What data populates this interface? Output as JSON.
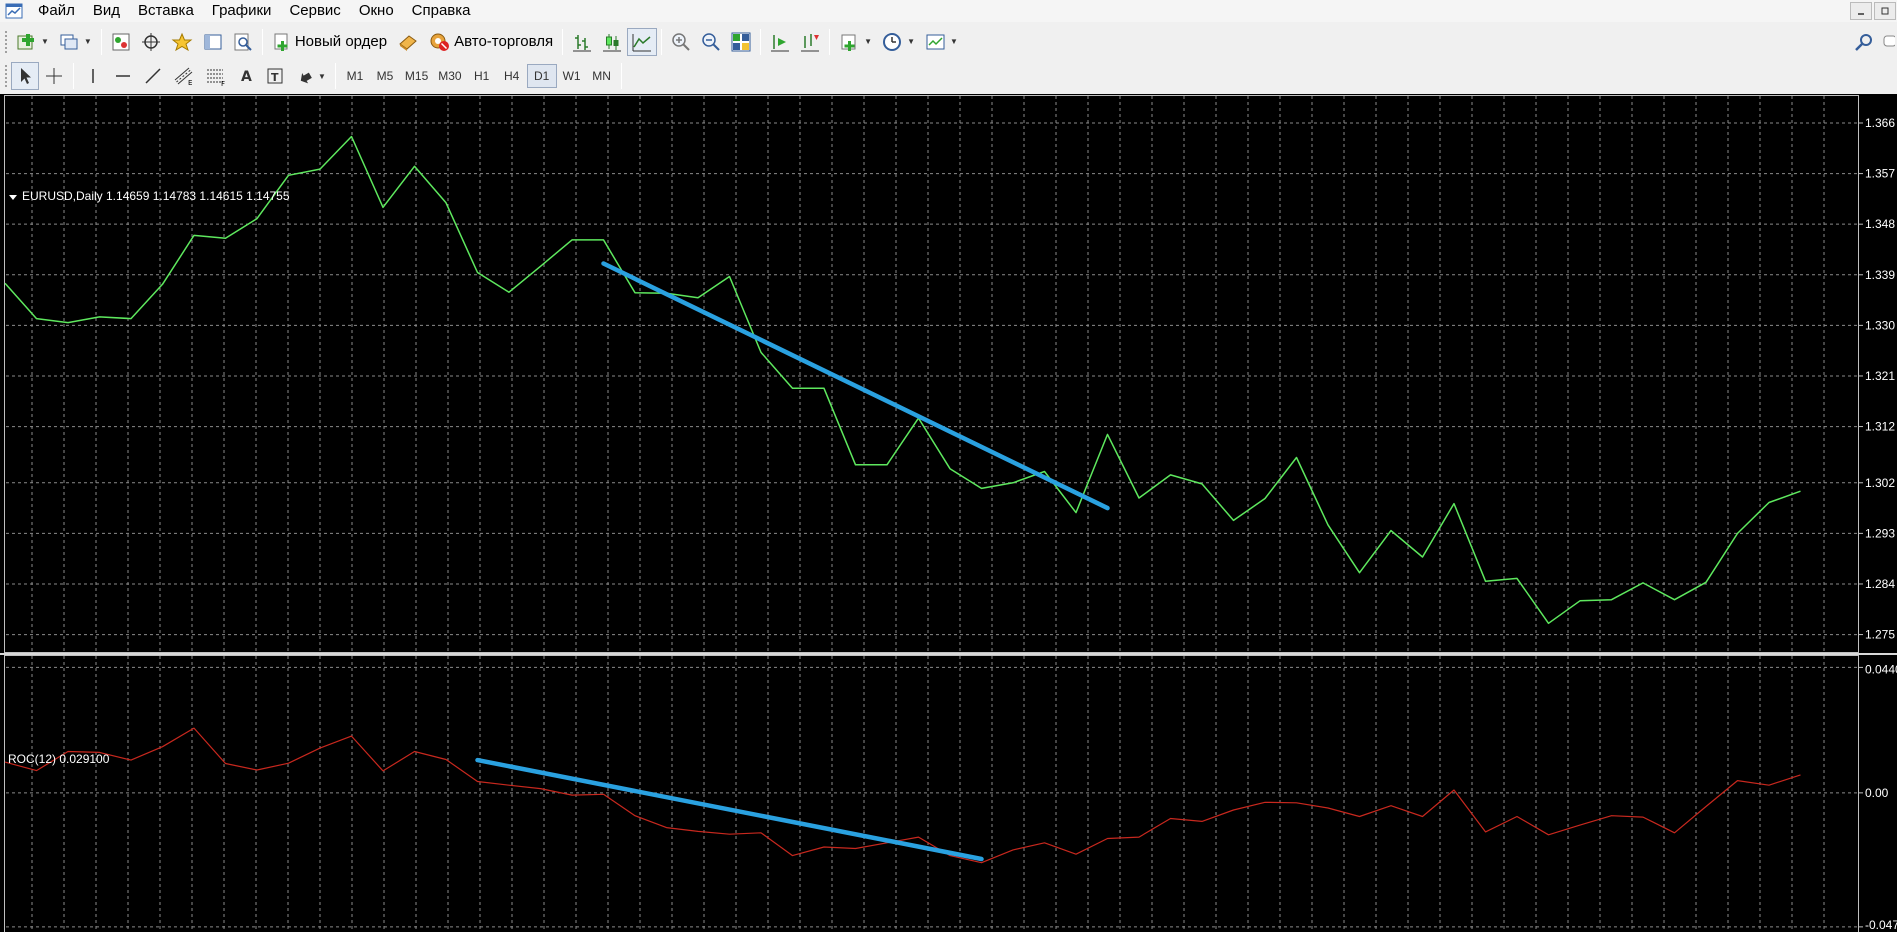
{
  "menu": {
    "items": [
      "Файл",
      "Вид",
      "Вставка",
      "Графики",
      "Сервис",
      "Окно",
      "Справка"
    ]
  },
  "toolbar": {
    "new_order_label": "Новый ордер",
    "autotrading_label": "Авто-торговля",
    "timeframes": [
      "M1",
      "M5",
      "M15",
      "M30",
      "H1",
      "H4",
      "D1",
      "W1",
      "MN"
    ],
    "active_timeframe": "D1"
  },
  "chart": {
    "main_label": "EURUSD,Daily  1.14659 1.14783 1.14615 1.14755",
    "indicator_label": "ROC(12) 0.029100",
    "main_ticks": [
      "1.366",
      "1.357",
      "1.348",
      "1.339",
      "1.330",
      "1.321",
      "1.312",
      "1.302",
      "1.293",
      "1.284",
      "1.275"
    ],
    "indicator_ticks": [
      "0.0440",
      "0.00",
      "-0.047"
    ],
    "colors": {
      "background": "#000000",
      "grid": "#8a8a8a",
      "price_line": "#5ee85e",
      "indicator_line": "#c8281e",
      "trendline": "#2aa1e0",
      "frame": "#c0c0c0"
    }
  },
  "chart_data": [
    {
      "type": "line",
      "title": "EURUSD,Daily  1.14659 1.14783 1.14615 1.14755",
      "series": [
        {
          "values": [
            1.3375,
            1.3312,
            1.3305,
            1.3315,
            1.3312,
            1.3373,
            1.346,
            1.3455,
            1.349,
            1.3567,
            1.3578,
            1.3636,
            1.351,
            1.3583,
            1.3518,
            1.3394,
            1.3359,
            1.3405,
            1.3452,
            1.3452,
            1.3358,
            1.3357,
            1.3349,
            1.3387,
            1.3252,
            1.3188,
            1.3188,
            1.3052,
            1.3052,
            1.3135,
            1.3045,
            1.301,
            1.302,
            1.304,
            1.2967,
            1.3106,
            1.2993,
            1.3034,
            1.3018,
            1.2953,
            1.2992,
            1.3065,
            1.2945,
            1.286,
            1.2935,
            1.2888,
            1.2983,
            1.2845,
            1.285,
            1.277,
            1.281,
            1.2812,
            1.2842,
            1.2812,
            1.2843,
            1.293,
            1.2985,
            1.3005
          ]
        }
      ],
      "ticks": [
        1.366,
        1.357,
        1.348,
        1.339,
        1.33,
        1.321,
        1.312,
        1.302,
        1.293,
        1.284,
        1.275
      ],
      "ylim": [
        1.2719,
        1.3708
      ],
      "trendline": {
        "start": {
          "index": 19,
          "value": 1.341
        },
        "end": {
          "index": 35,
          "value": 1.2975
        }
      },
      "grid": true
    },
    {
      "type": "line",
      "title": "ROC(12) 0.029100",
      "series": [
        {
          "values": [
            0.0108,
            0.0078,
            0.0145,
            0.0142,
            0.0115,
            0.0162,
            0.0227,
            0.0103,
            0.008,
            0.0104,
            0.0157,
            0.0199,
            0.0077,
            0.0145,
            0.0117,
            0.004,
            0.0027,
            0.0015,
            -0.0008,
            -0.0005,
            -0.008,
            -0.0122,
            -0.0135,
            -0.0145,
            -0.014,
            -0.022,
            -0.019,
            -0.0195,
            -0.0175,
            -0.0155,
            -0.022,
            -0.0245,
            -0.02,
            -0.0175,
            -0.0215,
            -0.016,
            -0.0155,
            -0.009,
            -0.01,
            -0.006,
            -0.0033,
            -0.0035,
            -0.0053,
            -0.0083,
            -0.0045,
            -0.0083,
            0.001,
            -0.0137,
            -0.0083,
            -0.0147,
            -0.0113,
            -0.008,
            -0.0085,
            -0.014,
            -0.0048,
            0.0043,
            0.0027,
            0.0063
          ]
        }
      ],
      "ticks": [
        0.044,
        0.0,
        -0.047
      ],
      "ylim": [
        -0.0488,
        0.048
      ],
      "trendline": {
        "start": {
          "index": 15,
          "value": 0.0115
        },
        "end": {
          "index": 31,
          "value": -0.0232
        }
      },
      "grid": true
    }
  ]
}
